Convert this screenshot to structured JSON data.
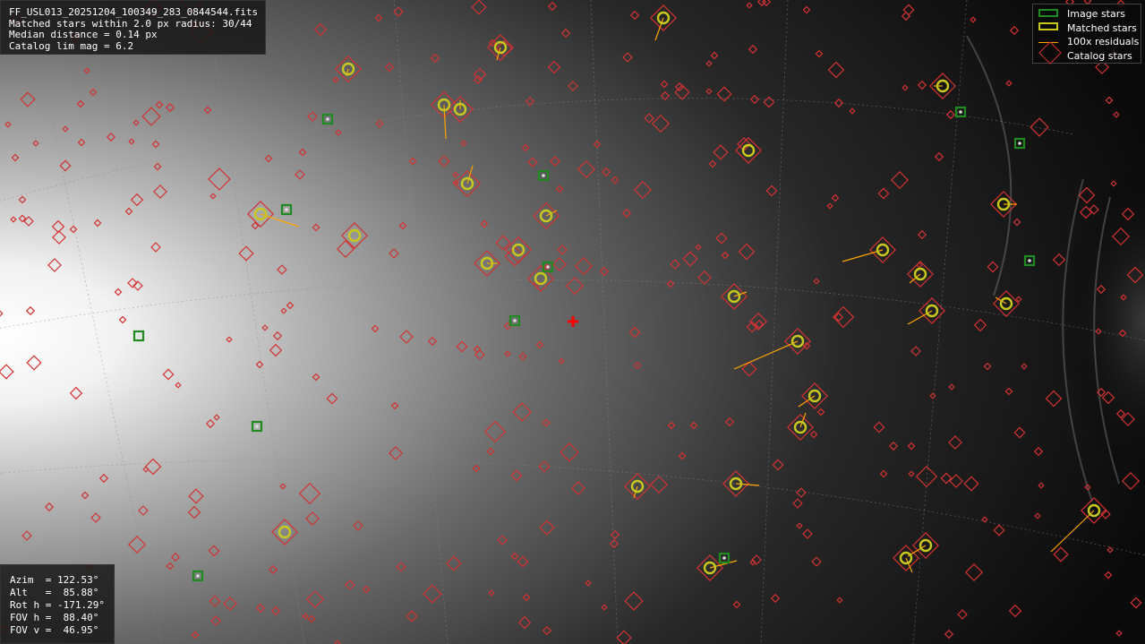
{
  "info": {
    "filename": "FF_USL013_20251204_100349_283_0844544.fits",
    "matched": "Matched stars within 2.0 px radius: 30/44",
    "median": "Median distance = 0.14 px",
    "limmag": "Catalog lim mag = 6.2"
  },
  "pointing": {
    "azim": "Azim  = 122.53°",
    "alt": "Alt   =  85.88°",
    "rot": "Rot h = -171.29°",
    "fovh": "FOV h =  88.40°",
    "fovv": "FOV v =  46.95°"
  },
  "legend": {
    "image_stars": "Image stars",
    "matched_stars": "Matched stars",
    "residuals": "100x residuals",
    "catalog_stars": "Catalog stars"
  },
  "colors": {
    "image_star": "#1f8a1f",
    "matched_star": "#c8c81e",
    "residual": "#ffa500",
    "catalog_star": "#d23232",
    "center_marker": "#ff0000"
  },
  "icons": {
    "center_marker": "red-plus-icon"
  }
}
